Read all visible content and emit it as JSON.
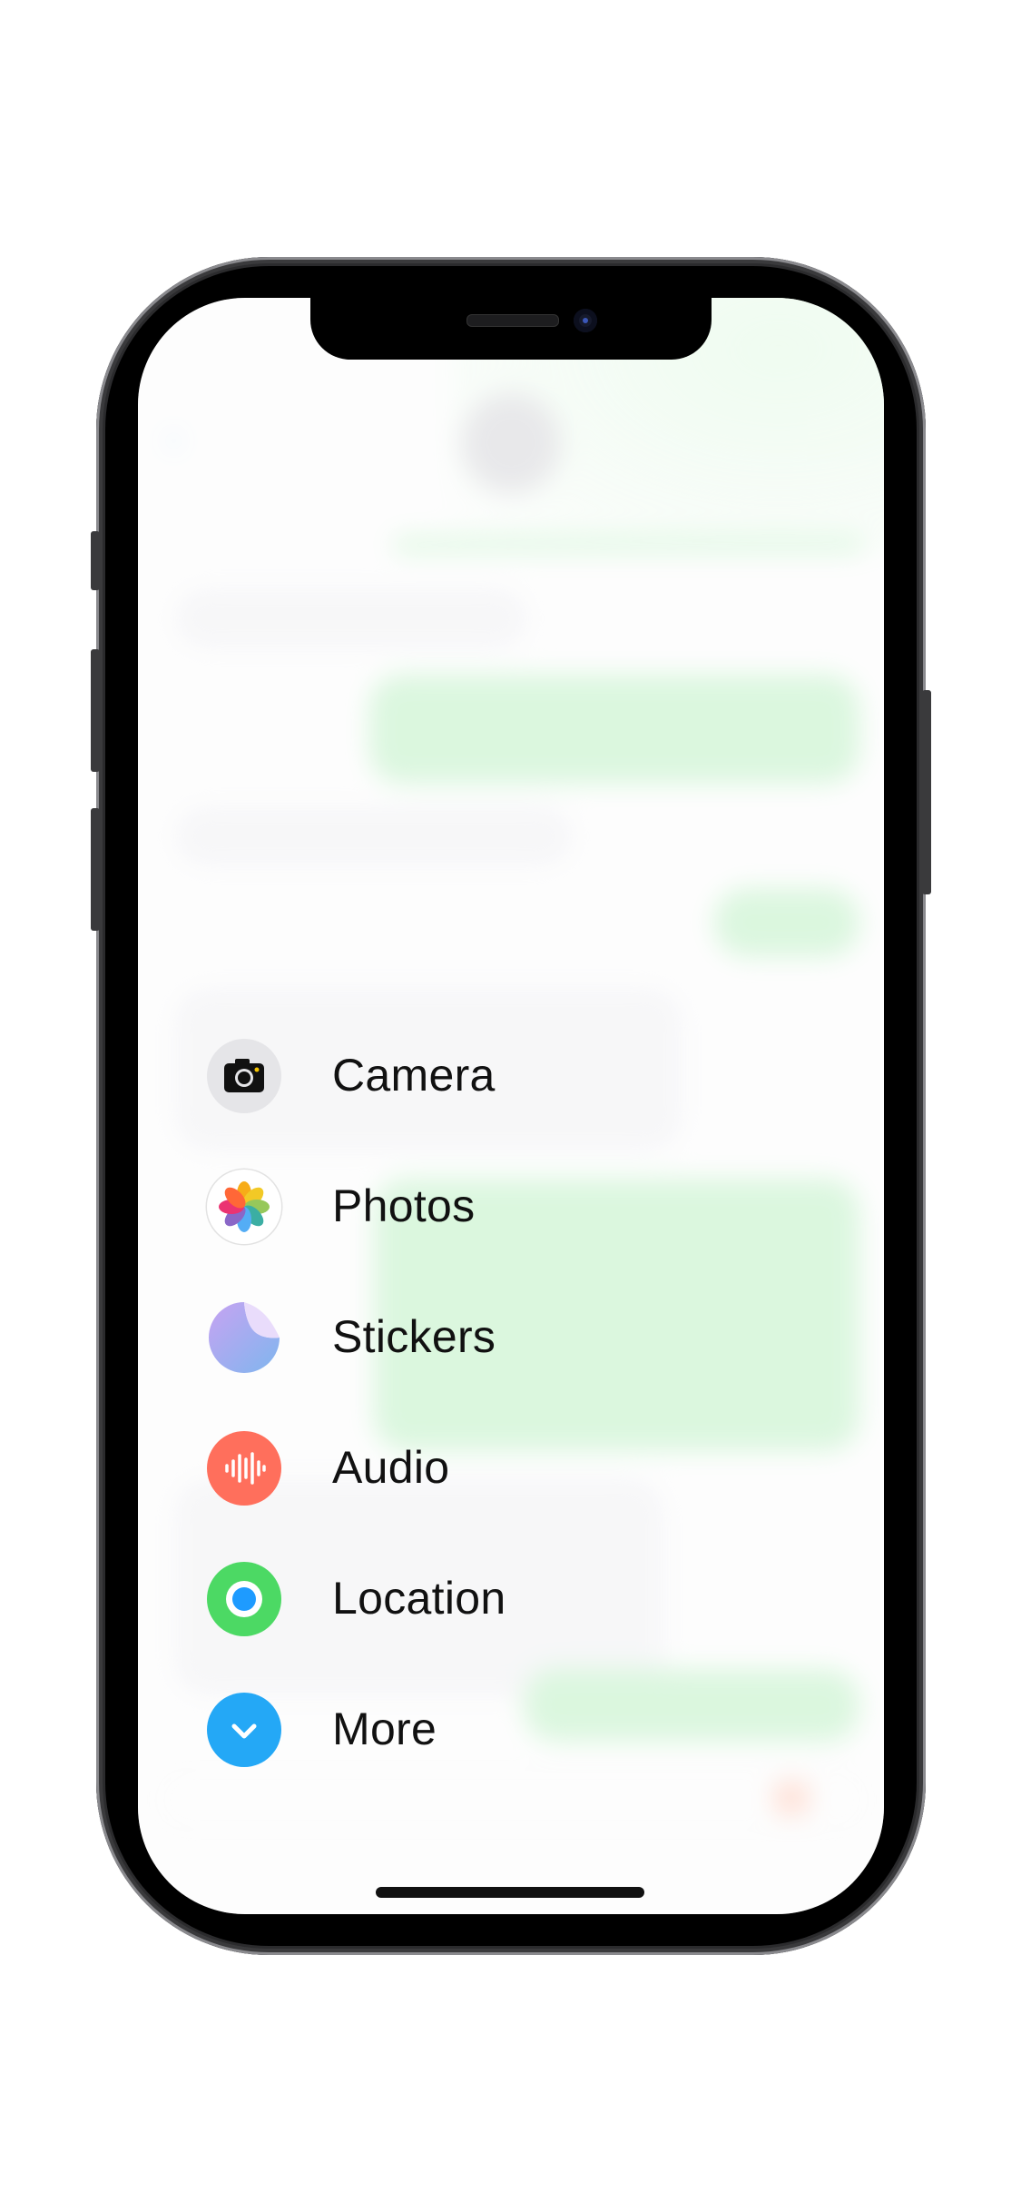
{
  "menu": {
    "items": [
      {
        "label": "Camera",
        "icon": "camera-icon"
      },
      {
        "label": "Photos",
        "icon": "photos-icon"
      },
      {
        "label": "Stickers",
        "icon": "stickers-icon"
      },
      {
        "label": "Audio",
        "icon": "audio-waveform-icon"
      },
      {
        "label": "Location",
        "icon": "location-pin-icon"
      },
      {
        "label": "More",
        "icon": "chevron-down-icon"
      }
    ]
  },
  "colors": {
    "audio": "#ff6f5c",
    "location": "#4cd964",
    "more": "#24a8f6",
    "camera_bg": "#e5e5e8",
    "outgoing_bubble": "#a9ecb2"
  }
}
